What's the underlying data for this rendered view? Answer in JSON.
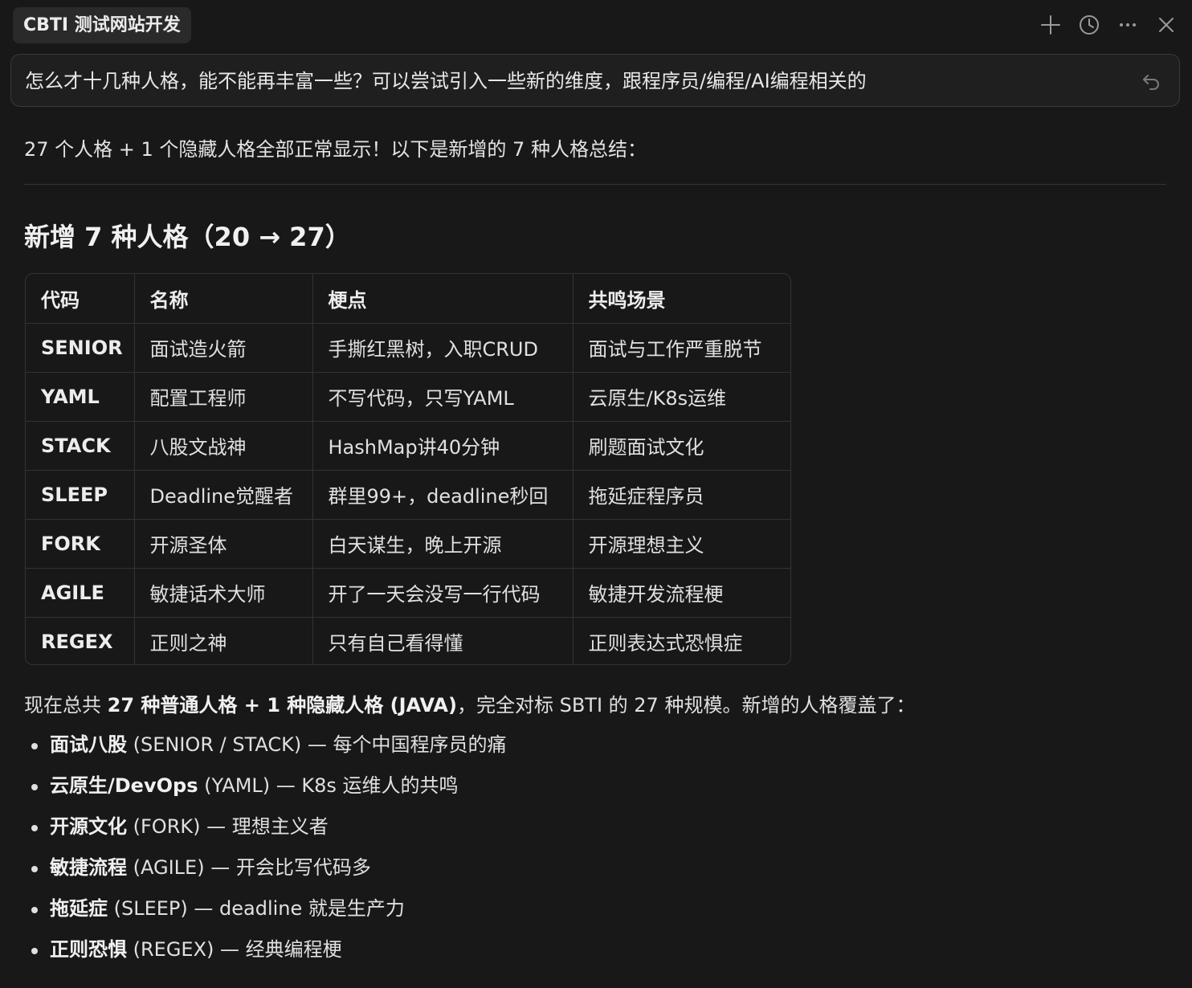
{
  "header": {
    "title": "CBTI 测试网站开发",
    "icons": [
      "plus-icon",
      "history-icon",
      "more-icon",
      "close-icon"
    ]
  },
  "prompt": {
    "text": "怎么才十几种人格，能不能再丰富一些？可以尝试引入一些新的维度，跟程序员/编程/AI编程相关的"
  },
  "response": {
    "intro": "27 个人格 + 1 个隐藏人格全部正常显示！以下是新增的 7 种人格总结：",
    "heading": "新增 7 种人格（20 → 27）",
    "table": {
      "headers": [
        "代码",
        "名称",
        "梗点",
        "共鸣场景"
      ],
      "rows": [
        [
          "SENIOR",
          "面试造火箭",
          "手撕红黑树，入职CRUD",
          "面试与工作严重脱节"
        ],
        [
          "YAML",
          "配置工程师",
          "不写代码，只写YAML",
          "云原生/K8s运维"
        ],
        [
          "STACK",
          "八股文战神",
          "HashMap讲40分钟",
          "刷题面试文化"
        ],
        [
          "SLEEP",
          "Deadline觉醒者",
          "群里99+，deadline秒回",
          "拖延症程序员"
        ],
        [
          "FORK",
          "开源圣体",
          "白天谋生，晚上开源",
          "开源理想主义"
        ],
        [
          "AGILE",
          "敏捷话术大师",
          "开了一天会没写一行代码",
          "敏捷开发流程梗"
        ],
        [
          "REGEX",
          "正则之神",
          "只有自己看得懂",
          "正则表达式恐惧症"
        ]
      ]
    },
    "summary": {
      "pre": "现在总共 ",
      "bold": "27 种普通人格 + 1 种隐藏人格 (JAVA)",
      "post": "，完全对标 SBTI 的 27 种规模。新增的人格覆盖了："
    },
    "bullets": [
      {
        "bold": "面试八股",
        "rest": " (SENIOR / STACK) — 每个中国程序员的痛"
      },
      {
        "bold": "云原生/DevOps",
        "rest": " (YAML) — K8s 运维人的共鸣"
      },
      {
        "bold": "开源文化",
        "rest": " (FORK) — 理想主义者"
      },
      {
        "bold": "敏捷流程",
        "rest": " (AGILE) — 开会比写代码多"
      },
      {
        "bold": "拖延症",
        "rest": " (SLEEP) — deadline 就是生产力"
      },
      {
        "bold": "正则恐惧",
        "rest": " (REGEX) — 经典编程梗"
      }
    ]
  },
  "colors": {
    "background": "#181818",
    "chip": "#2a2a2a",
    "border": "#333333",
    "text": "#e3e3e3"
  }
}
